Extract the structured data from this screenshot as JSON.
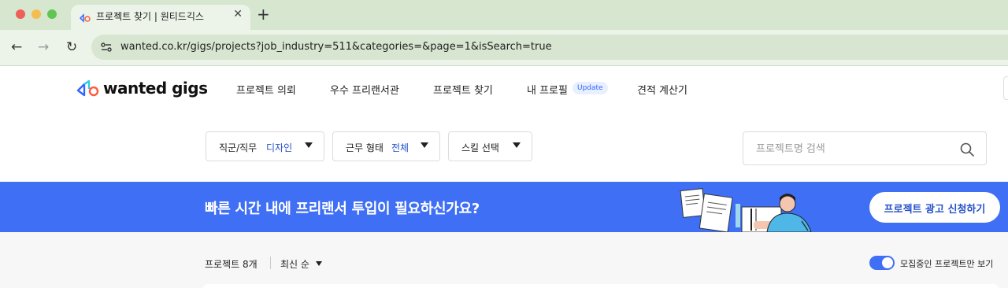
{
  "browser": {
    "tab": {
      "title": "프로젝트 찾기 | 원티드긱스",
      "close": "✕"
    },
    "new_tab": "+",
    "nav": {
      "back": "←",
      "forward": "→",
      "reload": "↻"
    },
    "url": "wanted.co.kr/gigs/projects?job_industry=511&categories=&page=1&isSearch=true"
  },
  "header": {
    "logo_text": "wanted gigs",
    "nav": [
      {
        "label": "프로젝트 의뢰"
      },
      {
        "label": "우수 프리랜서관"
      },
      {
        "label": "프로젝트 찾기"
      },
      {
        "label": "내 프로필"
      },
      {
        "label": "견적 계산기"
      }
    ],
    "update_badge": "Update"
  },
  "filters": {
    "job": {
      "label": "직군/직무",
      "value": "디자인"
    },
    "work_type": {
      "label": "근무 형태",
      "value": "전체"
    },
    "skill": {
      "label": "스킬 선택"
    }
  },
  "search": {
    "placeholder": "프로젝트명 검색"
  },
  "banner": {
    "text": "빠른 시간 내에 프리랜서 투입이 필요하신가요?",
    "button": "프로젝트 광고 신청하기"
  },
  "list": {
    "count": "프로젝트 8개",
    "sort": "최신 순",
    "toggle_label": "모집중인 프로젝트만 보기",
    "toggle_on": true
  },
  "colors": {
    "brand_blue": "#3f6ff5",
    "link_blue": "#2451c9",
    "chrome_green": "#d6e6cf"
  }
}
